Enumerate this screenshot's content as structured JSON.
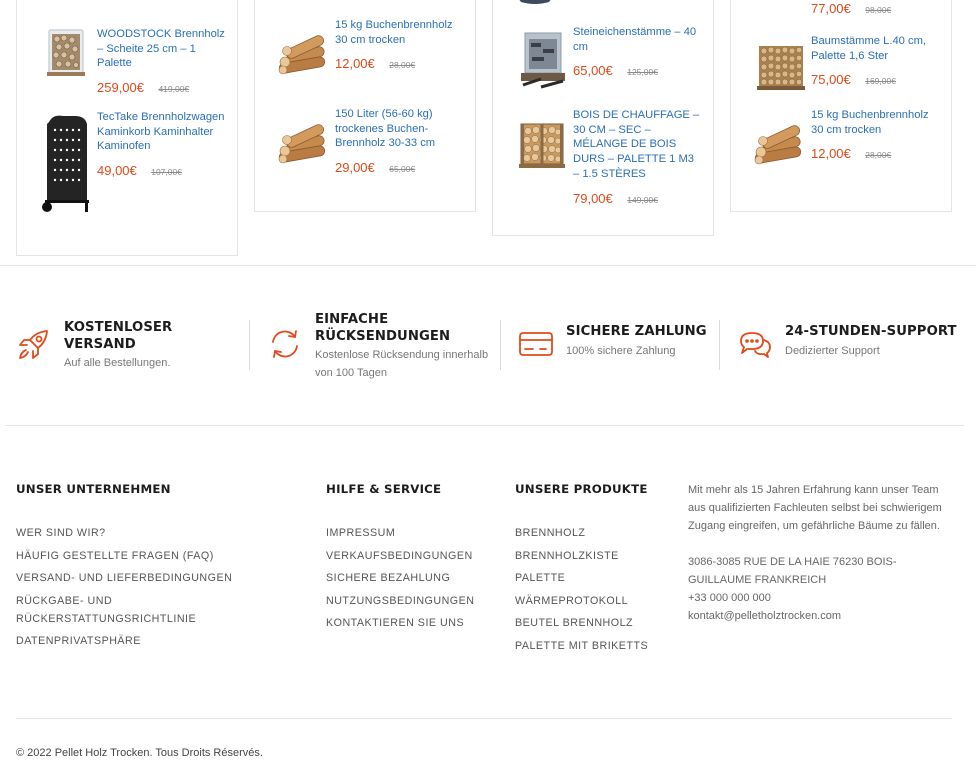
{
  "products": {
    "col1": [
      {
        "name": "WOODSTOCK Brennholz – Scheite 25 cm – 1 Palette",
        "price": "259,00€",
        "old_price": "419,00€",
        "image": "firewood-bag-image"
      },
      {
        "name": "TecTake Brennholzwagen Kaminkorb Kaminhalter Kaminofen",
        "price": "49,00€",
        "old_price": "107,00€",
        "image": "log-cart-image"
      }
    ],
    "col2": [
      {
        "name": "15 kg Buchenbrennholz 30 cm trocken",
        "price": "12,00€",
        "old_price": "28,00€",
        "image": "log-pile-image"
      },
      {
        "name": "150 Liter (56-60 kg) trockenes Buchen-Brennholz 30-33 cm",
        "price": "29,00€",
        "old_price": "65,00€",
        "image": "log-pile-image"
      }
    ],
    "col3": [
      {
        "name": "Steineichenstämme – 40 cm",
        "price": "65,00€",
        "old_price": "125,00€",
        "image": "log-bag-image"
      },
      {
        "name": "BOIS DE CHAUFFAGE – 30 CM – SEC – MÉLANGE DE BOIS DURS – PALETTE 1 M3 – 1.5 STÈRES",
        "price": "79,00€",
        "old_price": "149,00€",
        "image": "wood-crate-image"
      }
    ],
    "col4": [
      {
        "name": "",
        "price": "77,00€",
        "old_price": "98,00€",
        "image": ""
      },
      {
        "name": "Baumstämme L.40 cm, Palette 1,6 Ster",
        "price": "75,00€",
        "old_price": "169,00€",
        "image": "stacked-pallet-image"
      },
      {
        "name": "15 kg Buchenbrennholz 30 cm trocken",
        "price": "12,00€",
        "old_price": "28,00€",
        "image": "log-pile-image"
      }
    ]
  },
  "features": [
    {
      "title": "KOSTENLOSER VERSAND",
      "subtitle": "Auf alle Bestellungen.",
      "icon": "rocket-icon"
    },
    {
      "title": "EINFACHE RÜCKSENDUNGEN",
      "subtitle": "Kostenlose Rücksendung innerhalb von 100 Tagen",
      "icon": "refresh-icon"
    },
    {
      "title": "SICHERE ZAHLUNG",
      "subtitle": "100% sichere Zahlung",
      "icon": "credit-card-icon"
    },
    {
      "title": "24-STUNDEN-SUPPORT",
      "subtitle": "Dedizierter Support",
      "icon": "chat-bubbles-icon"
    }
  ],
  "footer": {
    "company": {
      "title": "UNSER UNTERNEHMEN",
      "links": [
        "WER SIND WIR?",
        "HÄUFIG GESTELLTE FRAGEN (FAQ)",
        "VERSAND- UND LIEFERBEDINGUNGEN",
        "RÜCKGABE- UND RÜCKERSTATTUNGSRICHTLINIE",
        "DATENPRIVATSPHÄRE"
      ]
    },
    "help": {
      "title": "HILFE & SERVICE",
      "links": [
        "IMPRESSUM",
        "VERKAUFSBEDINGUNGEN",
        "SICHERE BEZAHLUNG",
        "NUTZUNGSBEDINGUNGEN",
        "KONTAKTIEREN SIE UNS"
      ]
    },
    "products": {
      "title": "UNSERE PRODUKTE",
      "links": [
        "BRENNHOLZ",
        "BRENNHOLZKISTE",
        "PALETTE",
        "WÄRMEPROTOKOLL",
        "BEUTEL BRENNHOLZ",
        "PALETTE MIT BRIKETTS"
      ]
    },
    "about": {
      "text": "Mit mehr als 15 Jahren Erfahrung kann unser Team aus qualifizierten Fachleuten selbst bei schwierigem Zugang eingreifen, um gefährliche Bäume zu fällen.",
      "address": "3086-3085 RUE DE LA HAIE 76230 BOIS-GUILLAUME FRANKREICH",
      "phone": "+33 000 000 000",
      "email": "kontakt@pelletholztrocken.com"
    },
    "copyright": "© 2022 Pellet Holz Trocken. Tous Droits Réservés."
  },
  "colors": {
    "accent": "#e24a1a",
    "link": "#2a6fb6",
    "border": "#e4e4e4"
  }
}
